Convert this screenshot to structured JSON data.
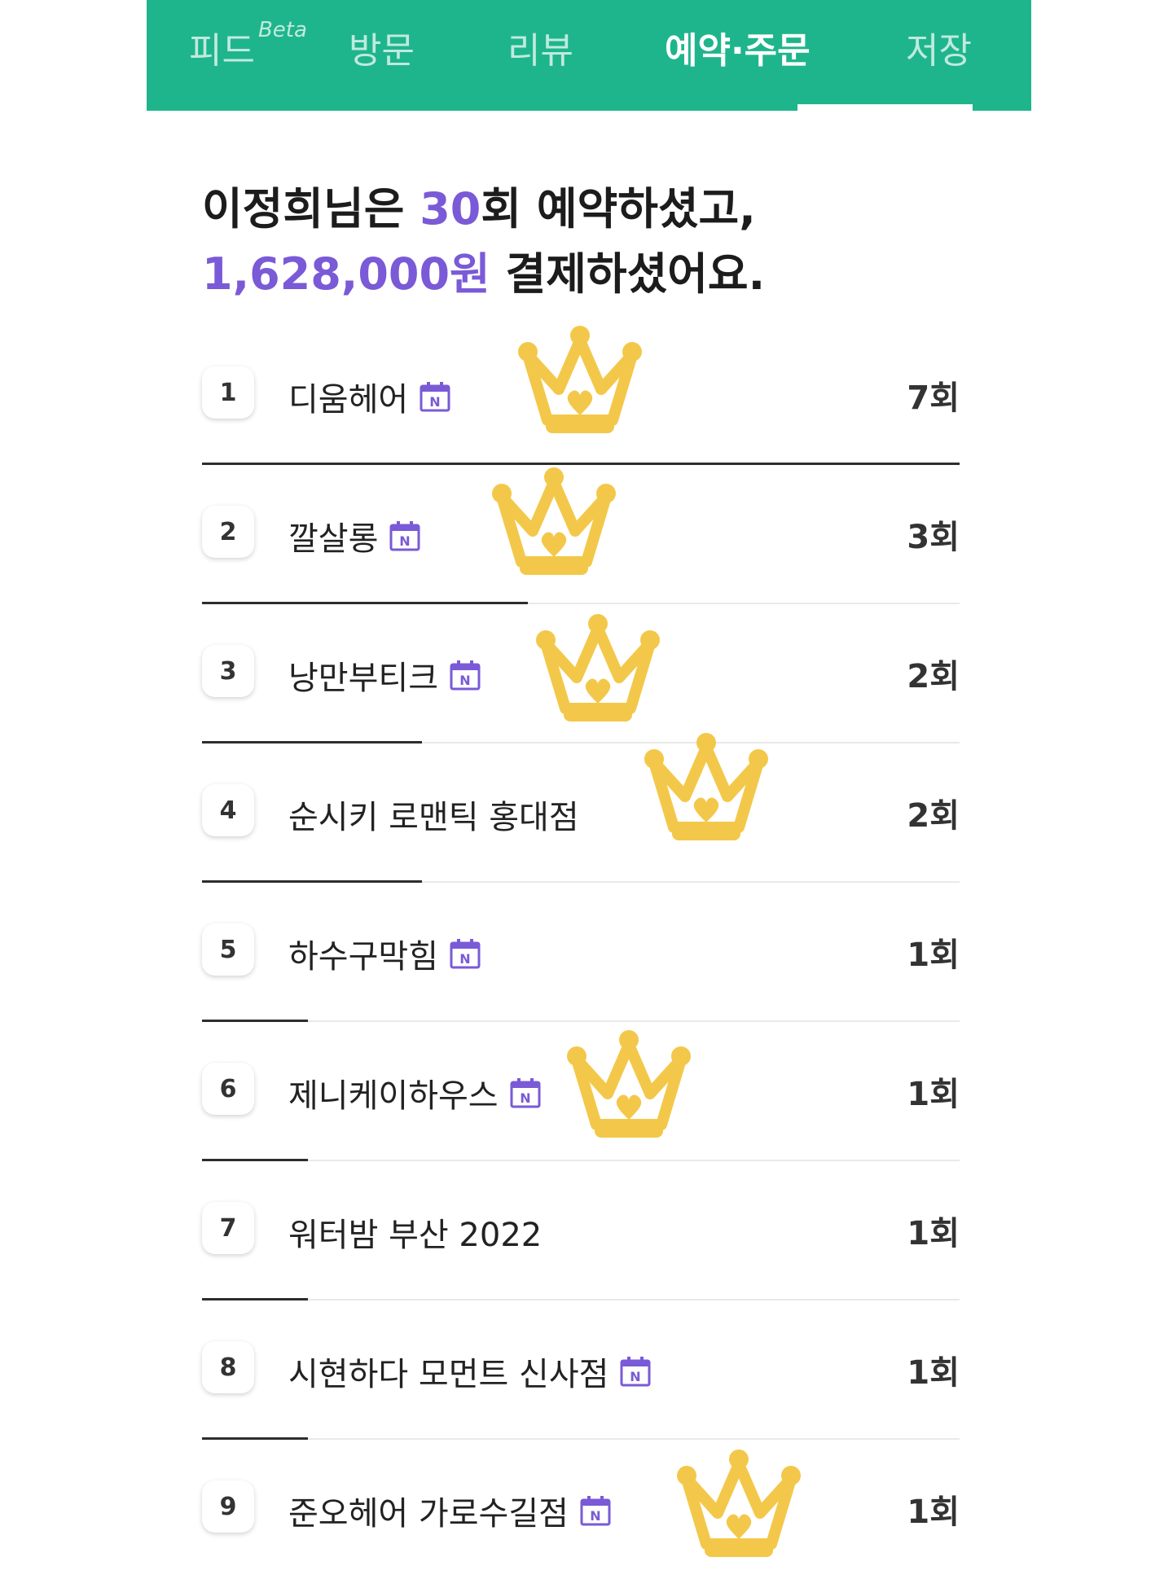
{
  "tabs": [
    {
      "label": "피드",
      "sup": "Beta"
    },
    {
      "label": "방문"
    },
    {
      "label": "리뷰"
    },
    {
      "label": "예약·주문"
    },
    {
      "label": "저장"
    }
  ],
  "summary": {
    "name_prefix": "이정희님은 ",
    "count": "30",
    "count_suffix": "회 예약하셨고,",
    "amount": "1,628,000원",
    "amount_suffix": " 결제하셨어요."
  },
  "colors": {
    "header": "#1fb58c",
    "accent": "#7a5ad6",
    "crown": "#f3c84a"
  },
  "rows": [
    {
      "rank": "1",
      "name": "디움헤어",
      "count": "7회",
      "has_badge": true
    },
    {
      "rank": "2",
      "name": "깔살롱",
      "count": "3회",
      "has_badge": true
    },
    {
      "rank": "3",
      "name": "낭만부티크",
      "count": "2회",
      "has_badge": true
    },
    {
      "rank": "4",
      "name": "순시키 로맨틱 홍대점",
      "count": "2회",
      "has_badge": false
    },
    {
      "rank": "5",
      "name": "하수구막힘",
      "count": "1회",
      "has_badge": true
    },
    {
      "rank": "6",
      "name": "제니케이하우스",
      "count": "1회",
      "has_badge": true
    },
    {
      "rank": "7",
      "name": "워터밤 부산 2022",
      "count": "1회",
      "has_badge": false
    },
    {
      "rank": "8",
      "name": "시현하다 모먼트 신사점",
      "count": "1회",
      "has_badge": true
    },
    {
      "rank": "9",
      "name": "준오헤어 가로수길점",
      "count": "1회",
      "has_badge": true
    }
  ],
  "badge_letter": "N",
  "progress": {
    "fractions": [
      1.0,
      0.43,
      0.29,
      0.29,
      0.14,
      0.14,
      0.14,
      0.14
    ]
  }
}
